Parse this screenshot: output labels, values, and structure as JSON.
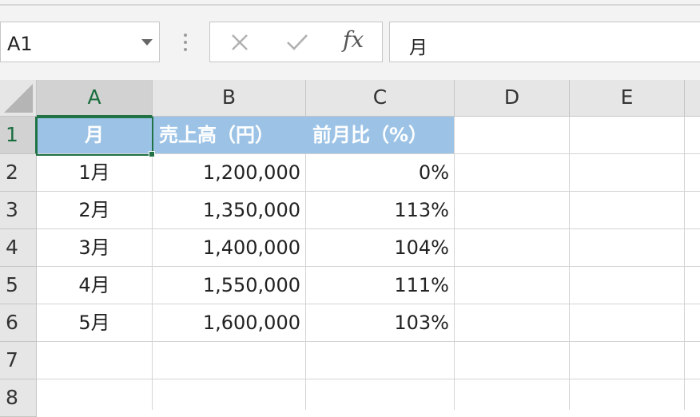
{
  "name_box": {
    "value": "A1"
  },
  "formula_bar": {
    "value": "月",
    "fx_label": "fx",
    "cancel_icon": "close-icon",
    "enter_icon": "check-icon"
  },
  "columns": [
    "A",
    "B",
    "C",
    "D",
    "E"
  ],
  "rows": [
    "1",
    "2",
    "3",
    "4",
    "5",
    "6",
    "7",
    "8"
  ],
  "active_cell": "A1",
  "colors": {
    "header_fill": "#9cc3e6",
    "selection": "#217346",
    "header_text": "#ffffff"
  },
  "table": {
    "headers": [
      "月",
      "売上高（円）",
      "前月比（%）"
    ],
    "rows": [
      [
        "1月",
        "1,200,000",
        "0%"
      ],
      [
        "2月",
        "1,350,000",
        "113%"
      ],
      [
        "3月",
        "1,400,000",
        "104%"
      ],
      [
        "4月",
        "1,550,000",
        "111%"
      ],
      [
        "5月",
        "1,600,000",
        "103%"
      ]
    ]
  }
}
